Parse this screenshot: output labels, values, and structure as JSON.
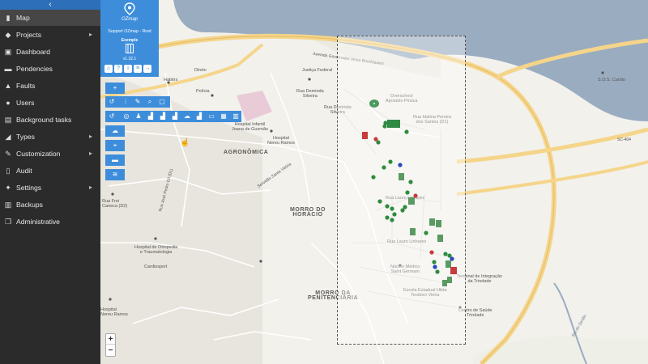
{
  "sidebar": {
    "collapse_label": "‹",
    "items": [
      {
        "label": "Map",
        "icon": "map-icon",
        "glyph": "▮",
        "active": true,
        "arrow": ""
      },
      {
        "label": "Projects",
        "icon": "briefcase-icon",
        "glyph": "◆",
        "arrow": "▸"
      },
      {
        "label": "Dashboard",
        "icon": "dashboard-icon",
        "glyph": "▣",
        "arrow": ""
      },
      {
        "label": "Pendencies",
        "icon": "car-icon",
        "glyph": "▬",
        "arrow": ""
      },
      {
        "label": "Faults",
        "icon": "warning-icon",
        "glyph": "▲",
        "arrow": ""
      },
      {
        "label": "Users",
        "icon": "user-icon",
        "glyph": "●",
        "arrow": ""
      },
      {
        "label": "Background tasks",
        "icon": "tasks-icon",
        "glyph": "▤",
        "arrow": ""
      },
      {
        "label": "Types",
        "icon": "tag-icon",
        "glyph": "◢",
        "arrow": "▸"
      },
      {
        "label": "Customization",
        "icon": "pencil-icon",
        "glyph": "✎",
        "arrow": "▸"
      },
      {
        "label": "Audit",
        "icon": "file-icon",
        "glyph": "▯",
        "arrow": ""
      },
      {
        "label": "Settings",
        "icon": "wrench-icon",
        "glyph": "✦",
        "arrow": "▸"
      },
      {
        "label": "Backups",
        "icon": "database-icon",
        "glyph": "▥",
        "arrow": ""
      },
      {
        "label": "Administrative",
        "icon": "copy-icon",
        "glyph": "❐",
        "arrow": ""
      }
    ]
  },
  "info_panel": {
    "logo": "OZmap",
    "support": "Support OZmap - Root",
    "project": "Exemple",
    "version": "v1.32.1"
  },
  "map": {
    "labels": {
      "agronomica": "AGRONÔMICA",
      "morro_horacio": "MORRO DO\nHORÁCIO",
      "morro_penitenciaria": "MORRO DA\nPENITENCIÁRIA",
      "justica_federal": "Justiça Federal",
      "rua_deminda_1": "Rua Deminda\nSilveira",
      "rua_deminda_2": "Rua Deminda\nSilveira",
      "hospital_infantil": "Hospital Infantil\nJoana de Gusmão",
      "hospital_nereu": "Hospital\nNereu Ramos",
      "hospital_ortopedia": "Hospital de Ortopedia\ne Traumatologia",
      "cardiosport": "Cardiosport",
      "nucleo_medico": "Núcleo Médico\nSaint Germain",
      "escola_estadual": "Escola Estadual Hilda\nTeodoro Vieira",
      "rua_lauro_1": "Rua Lauro Linhares",
      "rua_lauro_2": "Rua Lauro Linhares",
      "rua_idalina": "Rua Idalina Pereira\ndos Santos (D1)",
      "overschool": "Overschool\nApostolo Pirsica",
      "centro_saude": "Centro de Saúde\nTrindade",
      "integracao": "Terminal de Integração\nda Trindade",
      "sos": "S.O.S. Cardio",
      "sc404": "SC-404",
      "avenida_beira_mar": "Avenida Governador Irineu Bornhausen",
      "habitrs": "Habitrs",
      "direito": "Direto",
      "policia": "Polícia",
      "servidao": "Servidão Santa Vitória",
      "rua_frei": "Rua Frei\nCaneca (D2)",
      "rua_pedro": "Rua José Pedro Gil (D1)",
      "nereu_ramos_b": "Hospital\nNereu Ramos",
      "rio": "Rio do Sertão"
    }
  },
  "zoom": {
    "in_label": "+",
    "out_label": "−"
  }
}
